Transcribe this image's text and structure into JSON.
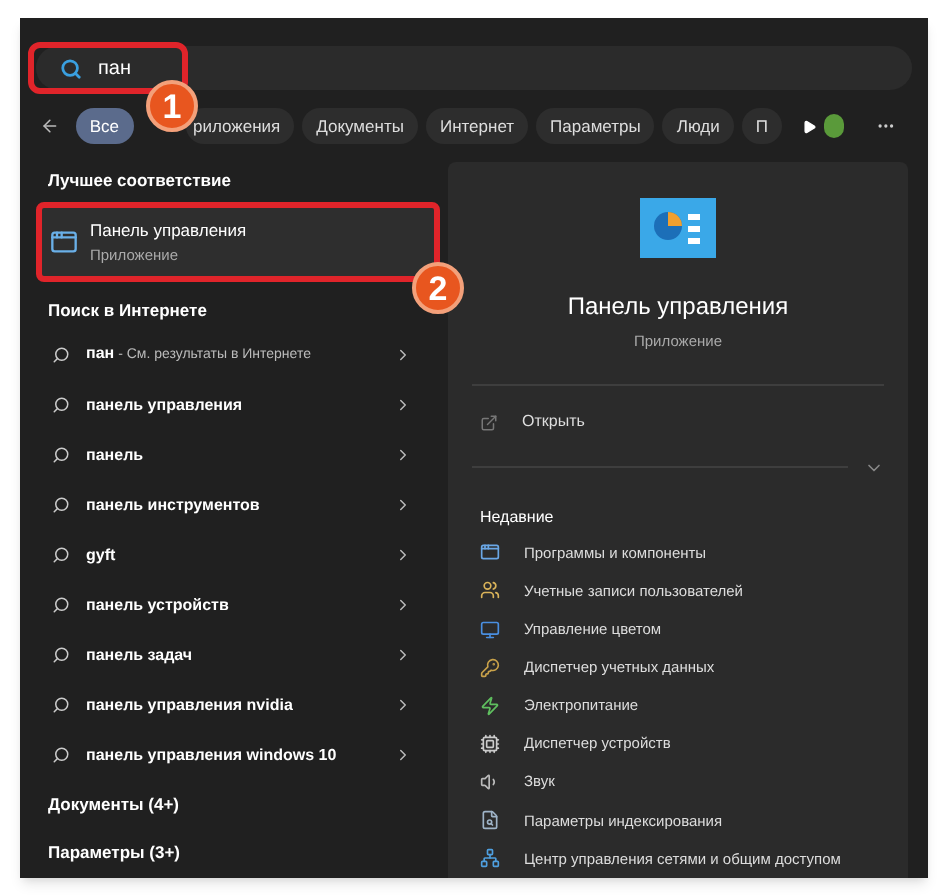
{
  "search": {
    "value": "пан"
  },
  "filters": [
    {
      "label": "Все",
      "selected": true
    },
    {
      "label": "риложения",
      "selected": false
    },
    {
      "label": "Документы",
      "selected": false
    },
    {
      "label": "Интернет",
      "selected": false
    },
    {
      "label": "Параметры",
      "selected": false
    },
    {
      "label": "Люди",
      "selected": false
    },
    {
      "label": "П",
      "selected": false
    }
  ],
  "annotations": [
    "1",
    "2"
  ],
  "best_match": {
    "heading": "Лучшее соответствие",
    "title": "Панель управления",
    "subtitle": "Приложение"
  },
  "web": {
    "heading": "Поиск в Интернете",
    "items": [
      {
        "query": "пан",
        "suffix": " - См. результаты в Интернете"
      },
      {
        "query": "панель управления"
      },
      {
        "query": "панель"
      },
      {
        "query": "панель инструментов"
      },
      {
        "query": "gyft"
      },
      {
        "query": "панель устройств"
      },
      {
        "query": "панель задач"
      },
      {
        "query": "панель управления nvidia"
      },
      {
        "query": "панель управления windows 10"
      }
    ]
  },
  "sections": [
    "Документы (4+)",
    "Параметры (3+)"
  ],
  "detail": {
    "title": "Панель управления",
    "subtitle": "Приложение",
    "open": "Открыть",
    "recent_heading": "Недавние",
    "recent": [
      "Программы и компоненты",
      "Учетные записи пользователей",
      "Управление цветом",
      "Диспетчер учетных данных",
      "Электропитание",
      "Диспетчер устройств",
      "Звук",
      "Параметры индексирования",
      "Центр управления сетями и общим доступом"
    ]
  }
}
